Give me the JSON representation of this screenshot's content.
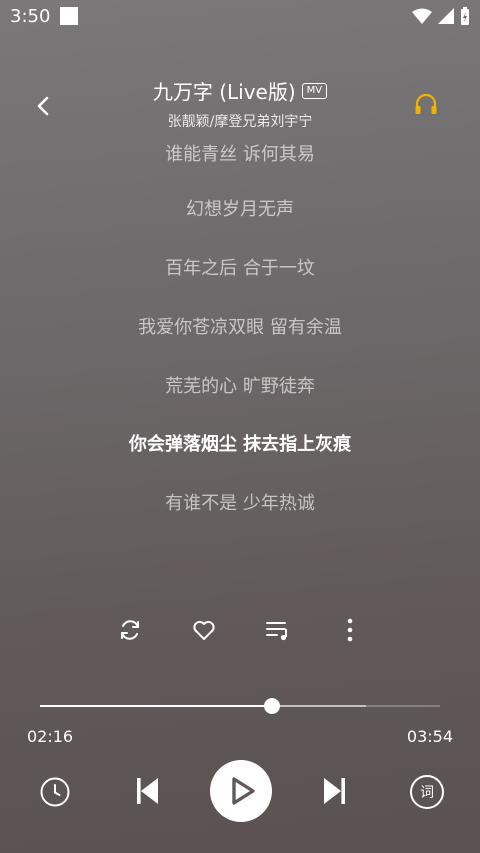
{
  "status_bar": {
    "time": "3:50"
  },
  "header": {
    "song_title": "九万字 (Live版)",
    "mv_badge": "MV",
    "artist": "张靓颖/摩登兄弟刘宇宁"
  },
  "lyrics": {
    "lines": [
      "谁能青丝 诉何其易",
      "幻想岁月无声",
      "百年之后 合于一坟",
      "我爱你苍凉双眼 留有余温",
      "荒芜的心 旷野徒奔",
      "你会弹落烟尘 抹去指上灰痕",
      "有谁不是 少年热诚"
    ],
    "active_index": 5
  },
  "actions": {
    "loop_icon": "repeat-icon",
    "like_icon": "heart-icon",
    "playlist_icon": "playlist-icon",
    "more_icon": "more-vertical-icon"
  },
  "progress": {
    "current_time": "02:16",
    "total_time": "03:54",
    "played_fraction": 0.58,
    "buffered_fraction": 0.815
  },
  "controls": {
    "timer_icon": "clock-icon",
    "prev_icon": "skip-previous-icon",
    "play_icon": "play-icon",
    "next_icon": "skip-next-icon",
    "lyric_toggle_label": "词"
  },
  "colors": {
    "headphone_accent": "#f0b400"
  }
}
